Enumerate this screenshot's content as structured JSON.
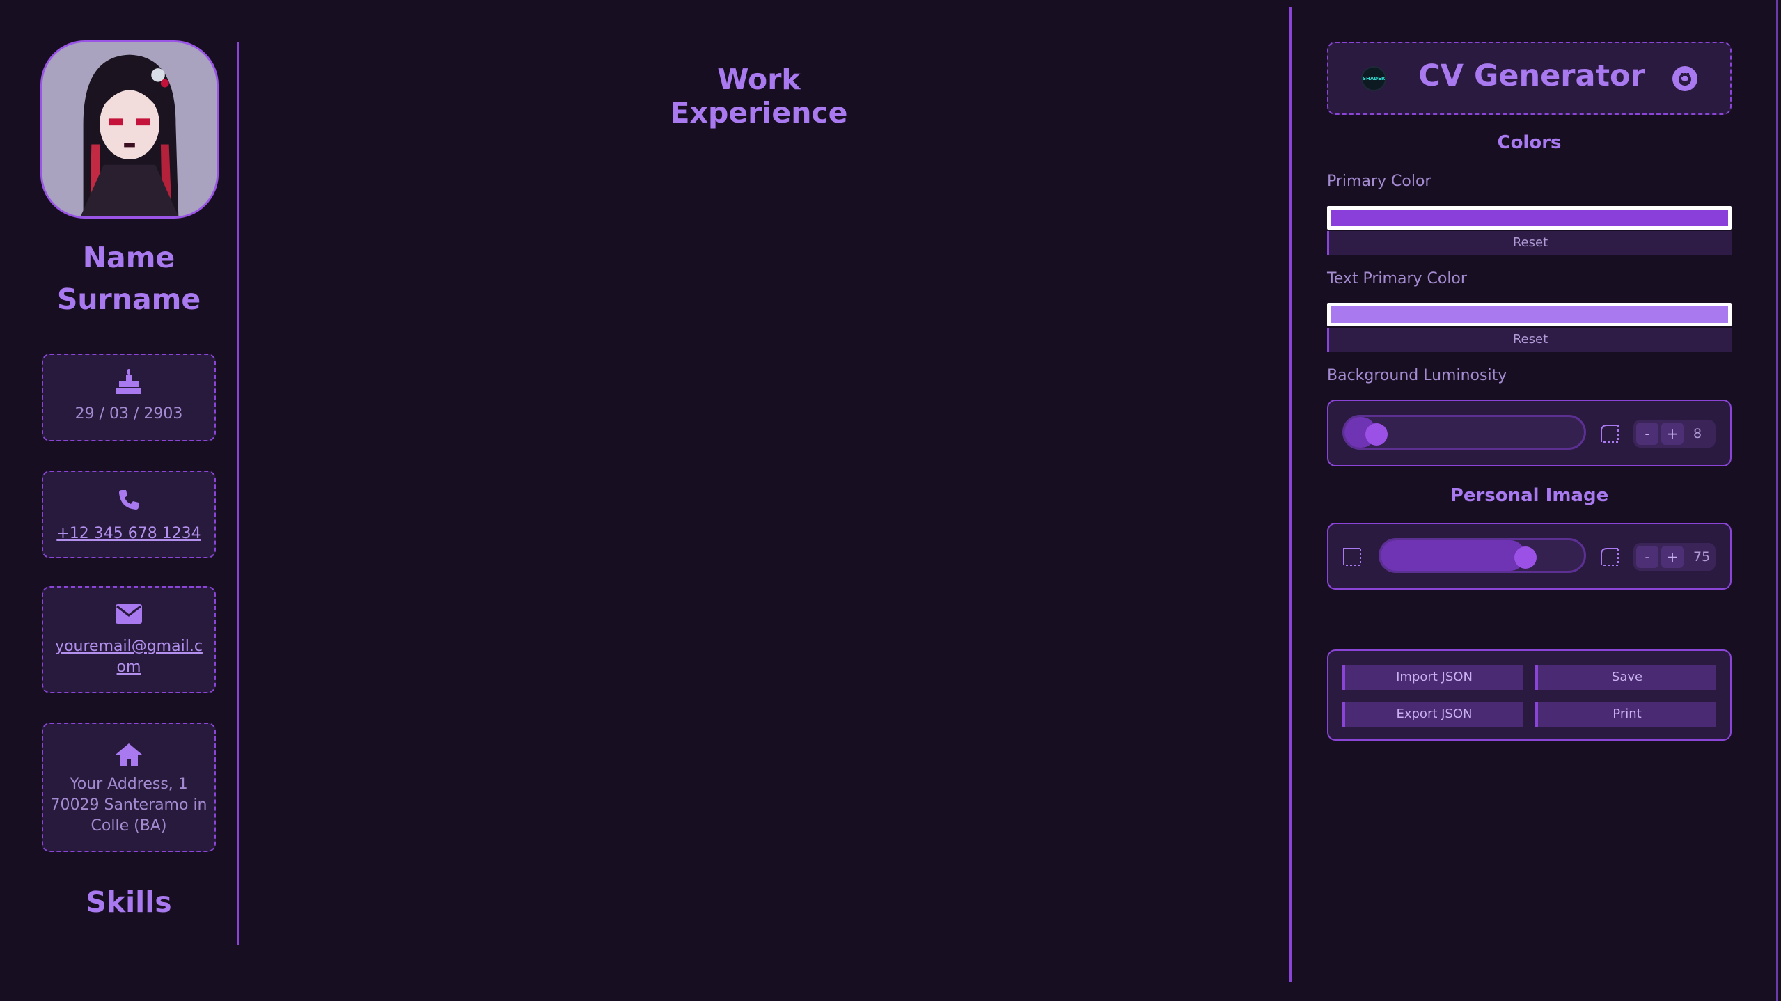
{
  "profile": {
    "first_name": "Name",
    "last_name": "Surname",
    "birthday": "29 / 03 / 2903",
    "phone": "+12 345 678 1234",
    "email_line1": "youremail@gmail.c",
    "email_line2": "om",
    "address_line1": "Your Address, 1",
    "address_line2": "70029 Santeramo in",
    "address_line3": "Colle (BA)",
    "skills_title": "Skills"
  },
  "main": {
    "title": "Work Experience"
  },
  "panel": {
    "title": "CV Generator",
    "logo_text": "SHADER",
    "colors_title": "Colors",
    "primary_color_label": "Primary Color",
    "primary_color_value": "#8a3fdb",
    "text_primary_color_label": "Text Primary Color",
    "text_primary_color_value": "#a979ef",
    "reset_label": "Reset",
    "bg_luminosity_label": "Background Luminosity",
    "bg_luminosity_value": "8",
    "bg_luminosity_fraction": 0.08,
    "personal_image_title": "Personal Image",
    "personal_image_value": "75",
    "personal_image_fraction": 0.75,
    "stepper_minus": "-",
    "stepper_plus": "+",
    "actions": {
      "import": "Import JSON",
      "save": "Save",
      "export": "Export JSON",
      "print": "Print"
    }
  },
  "icons": {
    "birthday": "cake-icon",
    "phone": "phone-icon",
    "email": "envelope-icon",
    "address": "home-icon",
    "github": "github-icon"
  },
  "theme": {
    "background": "#170f21",
    "accent": "#8a45d6",
    "text": "#a979ef"
  }
}
